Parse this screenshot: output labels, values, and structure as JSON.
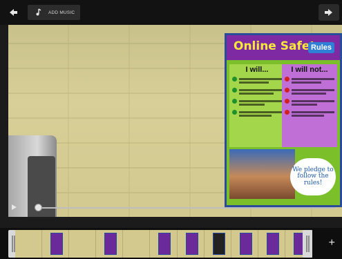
{
  "toolbar": {
    "add_music_label": "ADD MUSIC"
  },
  "icons": {
    "back": "arrow-left-icon",
    "forward": "arrow-right-icon",
    "music": "music-note-icon",
    "play": "play-icon",
    "add": "plus-icon"
  },
  "poster": {
    "title": "Online Safety",
    "rules_label": "Rules",
    "left_heading": "I will...",
    "right_heading": "I will not...",
    "pledge": "We pledge to follow the rules!"
  },
  "player": {
    "progress": 0.0
  },
  "filmstrip": {
    "add_label": "+"
  }
}
